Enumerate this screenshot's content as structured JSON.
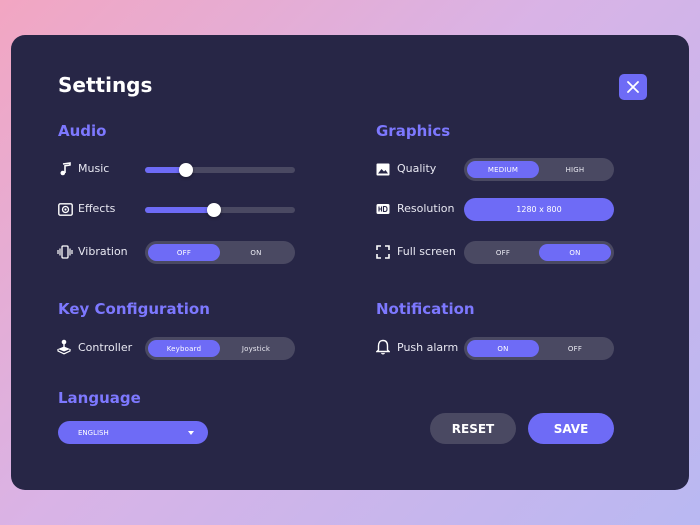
{
  "settings": {
    "title": "Settings",
    "close_icon": "close-icon",
    "audio": {
      "heading": "Audio",
      "music": {
        "label": "Music",
        "icon": "music-note-icon",
        "level": 0.27
      },
      "effects": {
        "label": "Effects",
        "icon": "speaker-icon",
        "level": 0.46
      },
      "vibration": {
        "label": "Vibration",
        "icon": "vibration-icon",
        "options": [
          "OFF",
          "ON"
        ],
        "selected": "OFF"
      }
    },
    "graphics": {
      "heading": "Graphics",
      "quality": {
        "label": "Quality",
        "icon": "image-icon",
        "options": [
          "MEDIUM",
          "HIGH"
        ],
        "selected": "MEDIUM"
      },
      "resolution": {
        "label": "Resolution",
        "icon": "hd-icon",
        "value": "1280 x 800"
      },
      "fullscreen": {
        "label": "Full screen",
        "icon": "fullscreen-icon",
        "options": [
          "OFF",
          "ON"
        ],
        "selected": "ON"
      }
    },
    "key_configuration": {
      "heading": "Key Configuration",
      "controller": {
        "label": "Controller",
        "icon": "joystick-icon",
        "options": [
          "Keyboard",
          "Joystick"
        ],
        "selected": "Keyboard"
      }
    },
    "notification": {
      "heading": "Notification",
      "push_alarm": {
        "label": "Push alarm",
        "icon": "bell-icon",
        "options": [
          "ON",
          "OFF"
        ],
        "selected": "ON"
      }
    },
    "language": {
      "heading": "Language",
      "selected": "ENGLISH",
      "icon": "chevron-down-icon"
    },
    "buttons": {
      "reset": "RESET",
      "save": "SAVE"
    },
    "colors": {
      "accent": "#6e6bf6",
      "panel": "#272646",
      "heading": "#7d78ff",
      "track": "#4a4962"
    }
  }
}
